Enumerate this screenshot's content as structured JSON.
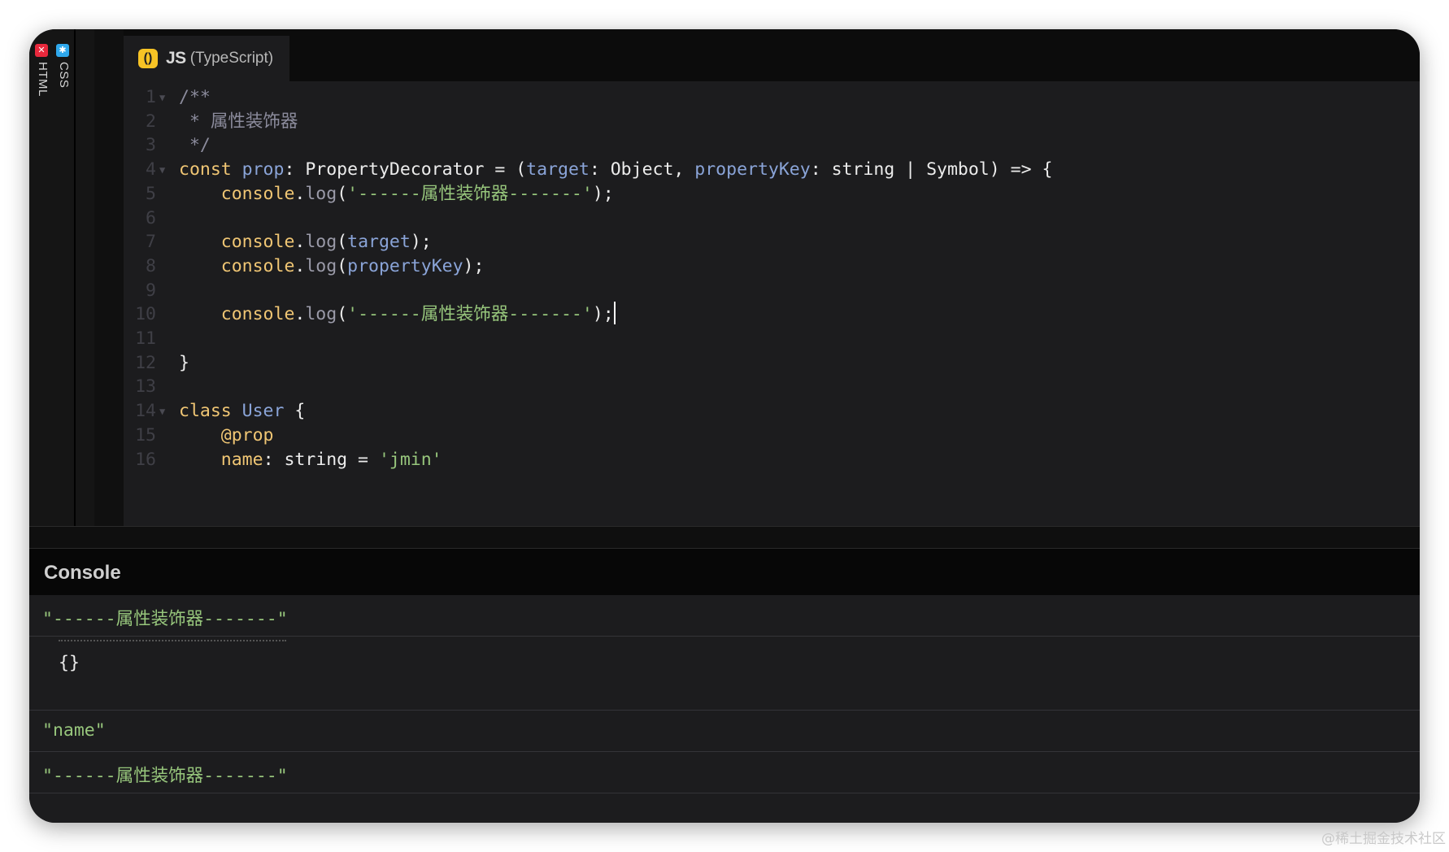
{
  "side_tabs": [
    {
      "label": "HTML",
      "icon": "html-icon",
      "icon_glyph": "✕",
      "color": "#e8283c"
    },
    {
      "label": "CSS",
      "icon": "css-icon",
      "icon_glyph": "✱",
      "color": "#2fa8ec"
    }
  ],
  "editor": {
    "tab_icon_glyph": "()",
    "tab_title": "JS",
    "tab_subtitle": "(TypeScript)",
    "lines": [
      {
        "n": "1",
        "fold": true,
        "tokens": [
          {
            "t": "/**",
            "c": "comment"
          }
        ]
      },
      {
        "n": "2",
        "fold": false,
        "tokens": [
          {
            "t": " * 属性装饰器",
            "c": "comment"
          }
        ]
      },
      {
        "n": "3",
        "fold": false,
        "tokens": [
          {
            "t": " */",
            "c": "comment"
          }
        ]
      },
      {
        "n": "4",
        "fold": true,
        "tokens": [
          {
            "t": "const ",
            "c": "kw"
          },
          {
            "t": "prop",
            "c": "var"
          },
          {
            "t": ": PropertyDecorator = (",
            "c": "white"
          },
          {
            "t": "target",
            "c": "var"
          },
          {
            "t": ": Object, ",
            "c": "white"
          },
          {
            "t": "propertyKey",
            "c": "var"
          },
          {
            "t": ": string | Symbol) => {",
            "c": "white"
          }
        ]
      },
      {
        "n": "5",
        "fold": false,
        "tokens": [
          {
            "t": "    console",
            "c": "prop"
          },
          {
            "t": ".",
            "c": "white"
          },
          {
            "t": "log",
            "c": "fn"
          },
          {
            "t": "(",
            "c": "white"
          },
          {
            "t": "'------属性装饰器-------'",
            "c": "str"
          },
          {
            "t": ");",
            "c": "white"
          }
        ]
      },
      {
        "n": "6",
        "fold": false,
        "tokens": []
      },
      {
        "n": "7",
        "fold": false,
        "tokens": [
          {
            "t": "    console",
            "c": "prop"
          },
          {
            "t": ".",
            "c": "white"
          },
          {
            "t": "log",
            "c": "fn"
          },
          {
            "t": "(",
            "c": "white"
          },
          {
            "t": "target",
            "c": "var"
          },
          {
            "t": ");",
            "c": "white"
          }
        ]
      },
      {
        "n": "8",
        "fold": false,
        "tokens": [
          {
            "t": "    console",
            "c": "prop"
          },
          {
            "t": ".",
            "c": "white"
          },
          {
            "t": "log",
            "c": "fn"
          },
          {
            "t": "(",
            "c": "white"
          },
          {
            "t": "propertyKey",
            "c": "var"
          },
          {
            "t": ");",
            "c": "white"
          }
        ]
      },
      {
        "n": "9",
        "fold": false,
        "tokens": []
      },
      {
        "n": "10",
        "fold": false,
        "cursor": true,
        "tokens": [
          {
            "t": "    console",
            "c": "prop"
          },
          {
            "t": ".",
            "c": "white"
          },
          {
            "t": "log",
            "c": "fn"
          },
          {
            "t": "(",
            "c": "white"
          },
          {
            "t": "'------属性装饰器-------'",
            "c": "str"
          },
          {
            "t": ");",
            "c": "white"
          }
        ]
      },
      {
        "n": "11",
        "fold": false,
        "tokens": []
      },
      {
        "n": "12",
        "fold": false,
        "tokens": [
          {
            "t": "}",
            "c": "white"
          }
        ]
      },
      {
        "n": "13",
        "fold": false,
        "tokens": []
      },
      {
        "n": "14",
        "fold": true,
        "tokens": [
          {
            "t": "class ",
            "c": "kw"
          },
          {
            "t": "User",
            "c": "cls"
          },
          {
            "t": " {",
            "c": "white"
          }
        ]
      },
      {
        "n": "15",
        "fold": false,
        "tokens": [
          {
            "t": "    @prop",
            "c": "prop"
          }
        ]
      },
      {
        "n": "16",
        "fold": false,
        "tokens": [
          {
            "t": "    name",
            "c": "prop"
          },
          {
            "t": ": string = ",
            "c": "white"
          },
          {
            "t": "'jmin'",
            "c": "str"
          }
        ]
      }
    ]
  },
  "console": {
    "title": "Console",
    "logs": [
      {
        "type": "string",
        "text": "\"------属性装饰器-------\""
      },
      {
        "type": "object",
        "text": "{}"
      },
      {
        "type": "string",
        "text": "\"name\""
      },
      {
        "type": "string",
        "text": "\"------属性装饰器-------\""
      }
    ]
  },
  "watermark": "@稀土掘金技术社区"
}
